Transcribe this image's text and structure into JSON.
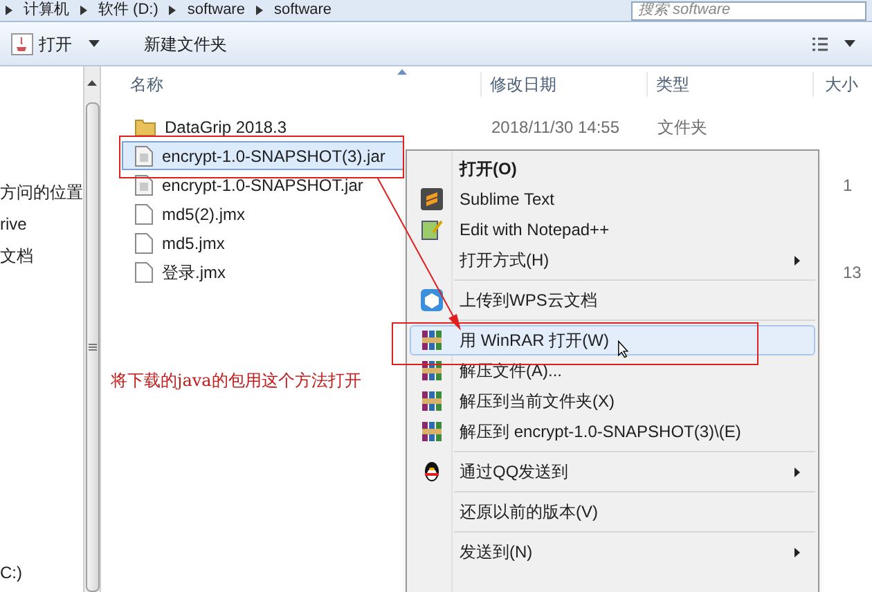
{
  "address_bar": {
    "crumbs": [
      "计算机",
      "软件 (D:)",
      "software",
      "software"
    ],
    "search": {
      "placeholder": "搜索 software"
    }
  },
  "toolbar": {
    "open": "打开",
    "new_folder": "新建文件夹"
  },
  "nav": {
    "items": [
      "方问的位置",
      "rive",
      "文档",
      "C:)"
    ]
  },
  "columns": [
    "名称",
    "修改日期",
    "类型",
    "大小"
  ],
  "files": [
    {
      "kind": "folder",
      "name": "DataGrip 2018.3",
      "date": "2018/11/30 14:55",
      "type": "文件夹",
      "selected": false
    },
    {
      "kind": "jar",
      "name": "encrypt-1.0-SNAPSHOT(3).jar",
      "selected": true
    },
    {
      "kind": "jar",
      "name": "encrypt-1.0-SNAPSHOT.jar",
      "size": "1",
      "selected": false
    },
    {
      "kind": "file",
      "name": "md5(2).jmx",
      "selected": false
    },
    {
      "kind": "file",
      "name": "md5.jmx",
      "selected": false
    },
    {
      "kind": "file",
      "name": "登录.jmx",
      "size": "13",
      "selected": false
    }
  ],
  "context_menu": [
    {
      "kind": "plain",
      "label": "打开(O)",
      "bold": true,
      "submenu": false,
      "selected": false
    },
    {
      "kind": "sublime",
      "label": "Sublime Text",
      "bold": false,
      "submenu": false,
      "selected": false
    },
    {
      "kind": "notepad",
      "label": "Edit with Notepad++",
      "bold": false,
      "submenu": false,
      "selected": false
    },
    {
      "kind": "plain",
      "label": "打开方式(H)",
      "bold": false,
      "submenu": true,
      "selected": false
    },
    {
      "kind": "separator"
    },
    {
      "kind": "wps",
      "label": "上传到WPS云文档",
      "bold": false,
      "submenu": false,
      "selected": false
    },
    {
      "kind": "separator"
    },
    {
      "kind": "winrar",
      "label": "用 WinRAR 打开(W)",
      "bold": false,
      "submenu": false,
      "selected": true
    },
    {
      "kind": "winrar",
      "label": "解压文件(A)...",
      "bold": false,
      "submenu": false,
      "selected": false
    },
    {
      "kind": "winrar",
      "label": "解压到当前文件夹(X)",
      "bold": false,
      "submenu": false,
      "selected": false
    },
    {
      "kind": "winrar",
      "label": "解压到 encrypt-1.0-SNAPSHOT(3)\\(E)",
      "bold": false,
      "submenu": false,
      "selected": false
    },
    {
      "kind": "separator"
    },
    {
      "kind": "qq",
      "label": "通过QQ发送到",
      "bold": false,
      "submenu": true,
      "selected": false
    },
    {
      "kind": "separator"
    },
    {
      "kind": "plain",
      "label": "还原以前的版本(V)",
      "bold": false,
      "submenu": false,
      "selected": false
    },
    {
      "kind": "separator"
    },
    {
      "kind": "plain",
      "label": "发送到(N)",
      "bold": false,
      "submenu": true,
      "selected": false
    }
  ],
  "annotation": {
    "note": "将下载的java的包用这个方法打开"
  }
}
